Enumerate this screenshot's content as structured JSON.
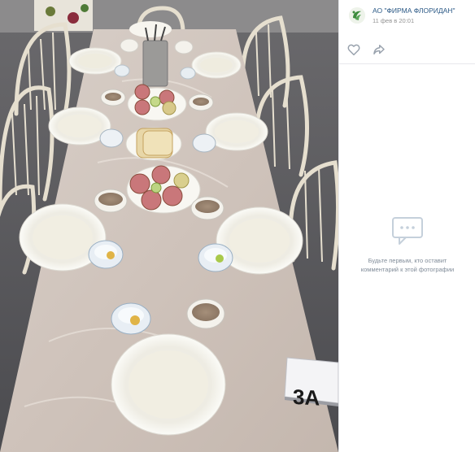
{
  "post": {
    "author": "АО \"ФИРМА ФЛОРИДАН\"",
    "date": "11 фев в 20:01"
  },
  "photo": {
    "table_sign": "3А"
  },
  "comments": {
    "empty_line1": "Будьте первым, кто оставит",
    "empty_line2": "комментарий к этой фотографии"
  },
  "colors": {
    "link": "#2a5885",
    "muted": "#939393",
    "comment_text": "#818c99",
    "icon": "#99a2ad",
    "logo_green": "#3d8b3d"
  },
  "icons": {
    "like": "heart-outline",
    "share": "share-arrow",
    "comments_empty": "chat-bubble"
  }
}
